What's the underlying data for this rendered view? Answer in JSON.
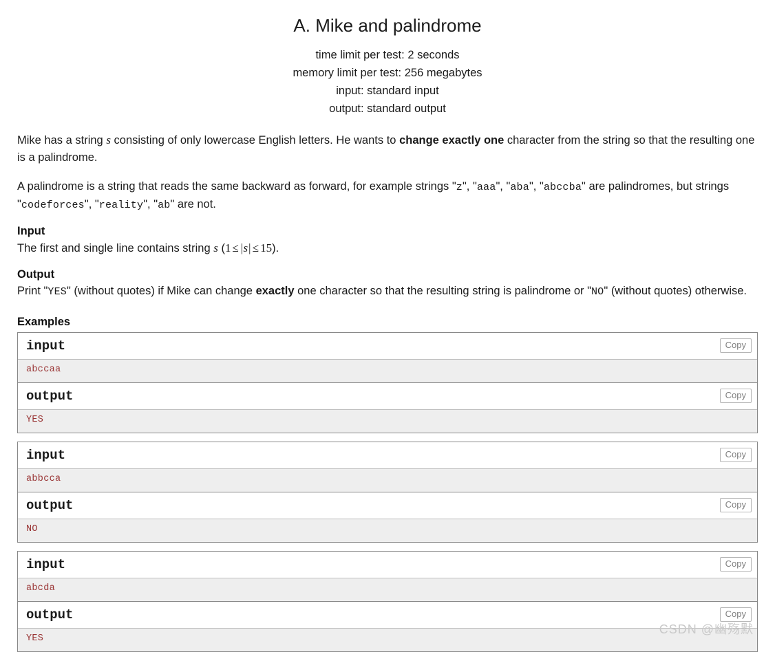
{
  "header": {
    "title": "A. Mike and palindrome",
    "limits": [
      "time limit per test: 2 seconds",
      "memory limit per test: 256 megabytes",
      "input: standard input",
      "output: standard output"
    ]
  },
  "statement": {
    "p1_a": "Mike has a string ",
    "p1_s": "s",
    "p1_b": " consisting of only lowercase English letters. He wants to ",
    "p1_bold": "change exactly one",
    "p1_c": " character from the string so that the resulting one is a palindrome.",
    "p2_a": "A palindrome is a string that reads the same backward as forward, for example strings \"",
    "p2_code1": "z",
    "p2_b": "\", \"",
    "p2_code2": "aaa",
    "p2_c": "\", \"",
    "p2_code3": "aba",
    "p2_d": "\", \"",
    "p2_code4": "abccba",
    "p2_e": "\" are palindromes, but strings \"",
    "p2_code5": "codeforces",
    "p2_f": "\", \"",
    "p2_code6": "reality",
    "p2_g": "\", \"",
    "p2_code7": "ab",
    "p2_h": "\" are not."
  },
  "input_section": {
    "title": "Input",
    "text_a": "The first and single line contains string ",
    "var": "s",
    "text_b": " (",
    "math_lo": "1",
    "math_rel1": "≤",
    "math_abs": "|s|",
    "math_rel2": "≤",
    "math_hi": "15",
    "text_c": ")."
  },
  "output_section": {
    "title": "Output",
    "text_a": "Print \"",
    "code_yes": "YES",
    "text_b": "\" (without quotes) if Mike can change ",
    "bold": "exactly",
    "text_c": " one character so that the resulting string is palindrome or \"",
    "code_no": "NO",
    "text_d": "\" (without quotes) otherwise."
  },
  "examples": {
    "title": "Examples",
    "copy_label": "Copy",
    "input_label": "input",
    "output_label": "output",
    "tests": [
      {
        "input": "abccaa",
        "output": "YES"
      },
      {
        "input": "abbcca",
        "output": "NO"
      },
      {
        "input": "abcda",
        "output": "YES"
      }
    ]
  },
  "watermark": "CSDN @幽殇默",
  "colors": {
    "sample_text": "#993333",
    "sample_bg": "#eeeeee",
    "border": "#888888"
  }
}
